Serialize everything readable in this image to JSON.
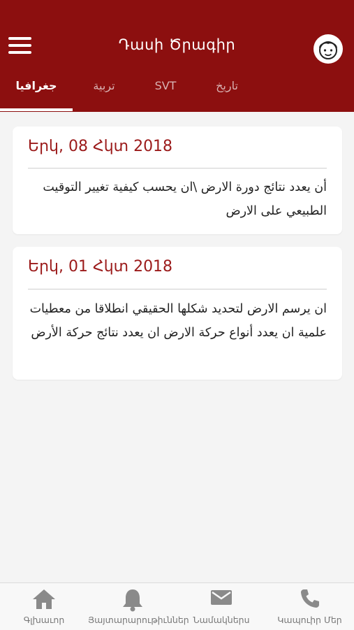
{
  "header": {
    "title": "Դասի Ծրագիր",
    "tabs": [
      {
        "label": "جغرافيا",
        "active": true
      },
      {
        "label": "تربية",
        "active": false
      },
      {
        "label": "SVT",
        "active": false
      },
      {
        "label": "تاريخ",
        "active": false
      }
    ]
  },
  "cards": [
    {
      "date": "Երկ, 08 Հկտ 2018",
      "text": "أن يعدد نتائج دورة الارض \\ان يحسب كيفية تغيير التوقيت الطبيعي على الارض"
    },
    {
      "date": "Երկ, 01 Հկտ 2018",
      "text": "ان يرسم الارض لتحديد شكلها الحقيقي انطلاقا من معطيات علمية ان يعدد أنواع حركة الارض ان يعدد نتائج حركة الأرض"
    }
  ],
  "bottom_nav": [
    {
      "label": "Գլխաւոր",
      "icon": "home-icon"
    },
    {
      "label": "Յայտարարութիւններ",
      "icon": "bell-icon"
    },
    {
      "label": "Նամակներս",
      "icon": "mail-icon"
    },
    {
      "label": "Կապուիր Մեր",
      "icon": "phone-icon"
    }
  ],
  "colors": {
    "primary": "#8c0f0f",
    "date_text": "#9b1a1a",
    "background": "#f4f4f4"
  }
}
